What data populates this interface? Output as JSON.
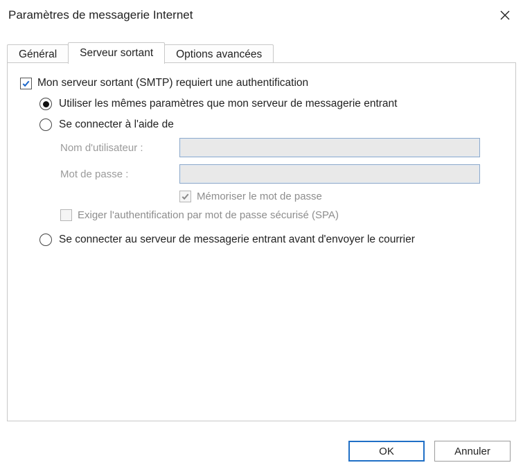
{
  "window": {
    "title": "Paramètres de messagerie Internet"
  },
  "tabs": {
    "general": "Général",
    "outgoing": "Serveur sortant",
    "advanced": "Options avancées"
  },
  "form": {
    "require_auth": "Mon serveur sortant (SMTP) requiert une authentification",
    "use_same": "Utiliser les mêmes paramètres que mon serveur de messagerie entrant",
    "logon_using": "Se connecter à l'aide de",
    "username_label": "Nom d'utilisateur :",
    "username_value": "",
    "password_label": "Mot de passe :",
    "password_value": "",
    "remember_pw": "Mémoriser le mot de passe",
    "require_spa": "Exiger l'authentification par mot de passe sécurisé (SPA)",
    "logon_incoming_first": "Se connecter au serveur de messagerie entrant avant d'envoyer le courrier"
  },
  "buttons": {
    "ok": "OK",
    "cancel": "Annuler"
  }
}
